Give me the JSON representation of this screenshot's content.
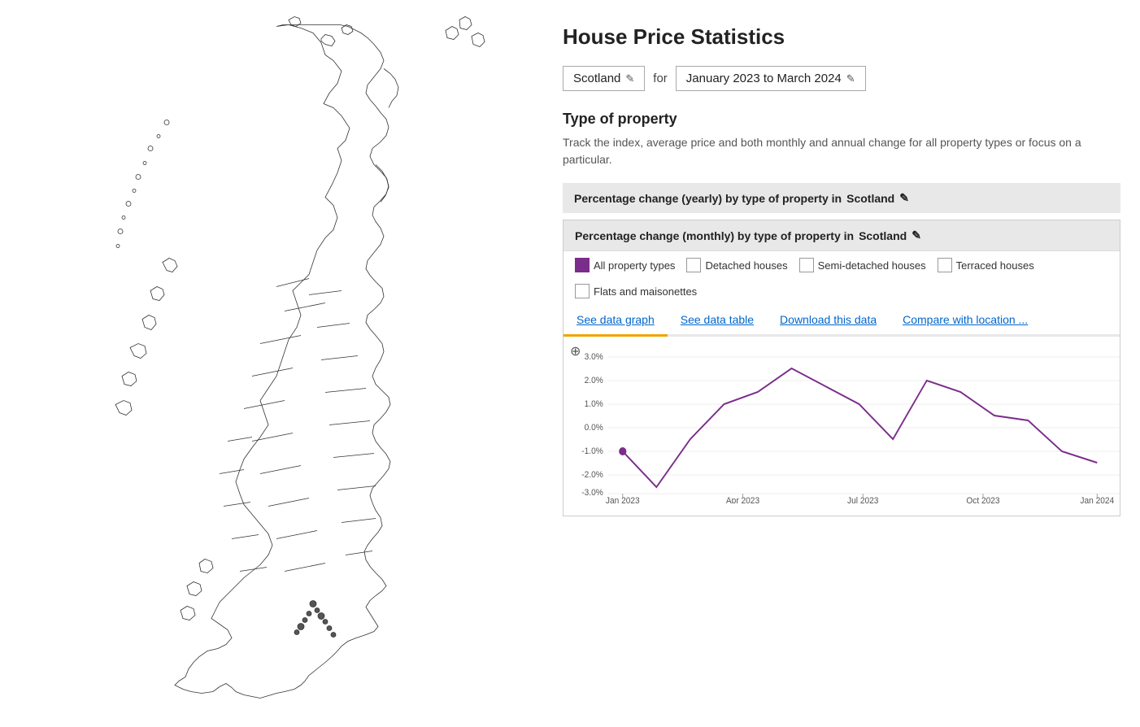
{
  "page": {
    "title": "House Price Statistics"
  },
  "location": {
    "label": "Scotland",
    "edit_icon": "✎"
  },
  "date_range": {
    "label": "January 2023 to March 2024",
    "edit_icon": "✎"
  },
  "for_label": "for",
  "section": {
    "heading": "Type of property",
    "description": "Track the index, average price and both monthly and annual change for all property types or focus on a particular."
  },
  "yearly_chart": {
    "title_prefix": "Percentage change (yearly) by type of property in",
    "location": "Scotland",
    "edit_icon": "✎"
  },
  "monthly_chart": {
    "title_prefix": "Percentage change (monthly) by type of property in",
    "location": "Scotland",
    "edit_icon": "✎"
  },
  "legend": {
    "items": [
      {
        "id": "all",
        "label": "All property types",
        "filled": true
      },
      {
        "id": "detached",
        "label": "Detached houses",
        "filled": false
      },
      {
        "id": "semi",
        "label": "Semi-detached houses",
        "filled": false
      },
      {
        "id": "terraced",
        "label": "Terraced houses",
        "filled": false
      },
      {
        "id": "flats",
        "label": "Flats and maisonettes",
        "filled": false
      }
    ]
  },
  "tabs": [
    {
      "id": "graph",
      "label": "See data graph",
      "active": true
    },
    {
      "id": "table",
      "label": "See data table",
      "active": false
    },
    {
      "id": "download",
      "label": "Download this data",
      "active": false
    },
    {
      "id": "compare",
      "label": "Compare with location ...",
      "active": false
    }
  ],
  "chart": {
    "y_labels": [
      "3.0%",
      "2.0%",
      "1.0%",
      "0.0%",
      "-1.0%",
      "-2.0%",
      "-3.0%"
    ],
    "x_labels": [
      "Jan 2023",
      "Apr 2023",
      "Jul 2023",
      "Oct 2023",
      "Jan 2024"
    ],
    "zoom_icon": "⊕"
  }
}
